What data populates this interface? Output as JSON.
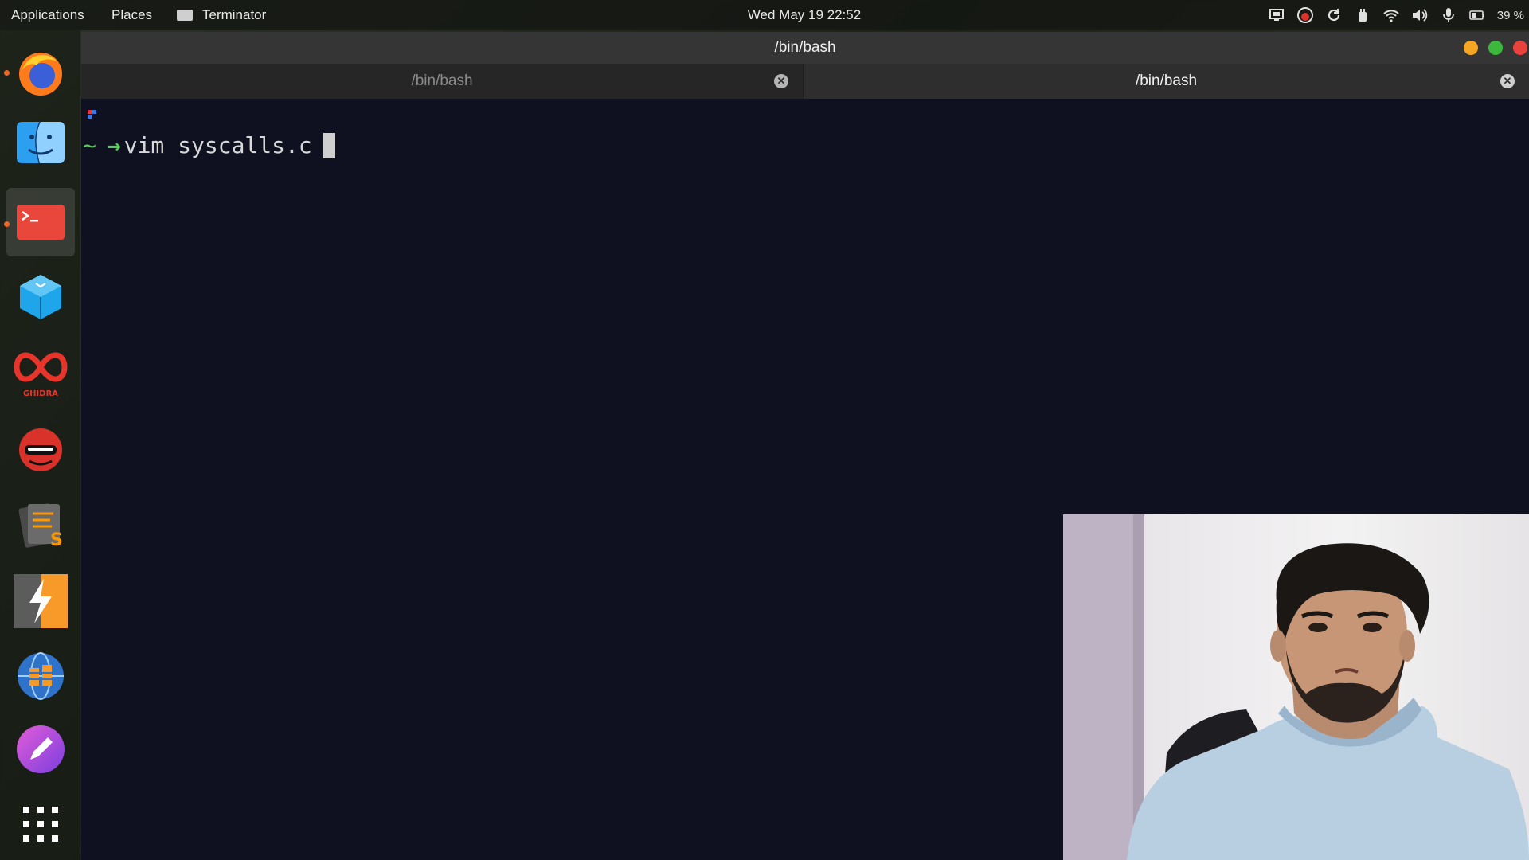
{
  "top_panel": {
    "applications": "Applications",
    "places": "Places",
    "active_app": "Terminator",
    "clock": "Wed May 19  22:52",
    "battery_percent": "39 %",
    "tray_icons": [
      "display-icon",
      "screen-recorder-icon",
      "sync-icon",
      "power-icon",
      "wifi-icon",
      "volume-icon",
      "microphone-icon",
      "battery-icon"
    ]
  },
  "dock": {
    "items": [
      "Firefox",
      "Finder",
      "Terminator",
      "VirtualBox",
      "Ghidra",
      "Anonymous",
      "Sublime Text",
      "Zap",
      "Network Manager",
      "Notes",
      "Show Applications"
    ],
    "active": "Terminator"
  },
  "window": {
    "title": "/bin/bash",
    "tabs": [
      {
        "label": "/bin/bash",
        "active": false
      },
      {
        "label": "/bin/bash",
        "active": true
      }
    ]
  },
  "terminal": {
    "prompt_tilde": "~",
    "prompt_arrow": "→",
    "command": "vim syscalls.c"
  },
  "colors": {
    "terminal_bg": "#0f1020",
    "prompt_green": "#4fd24f",
    "accent_orange": "#f26522"
  }
}
